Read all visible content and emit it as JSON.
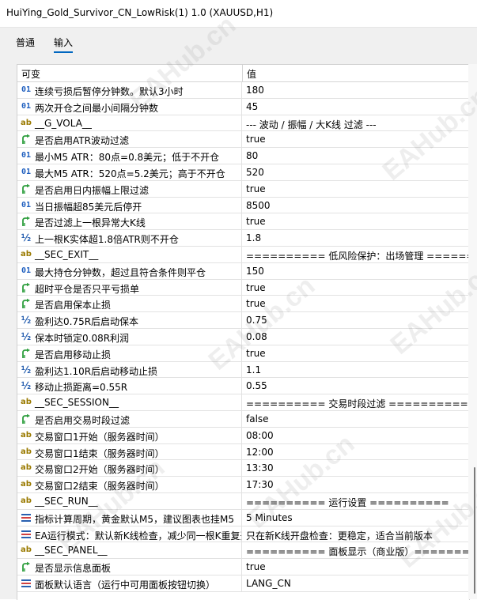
{
  "window": {
    "title": "HuiYing_Gold_Survivor_CN_LowRisk(1) 1.0 (XAUUSD,H1)"
  },
  "tabs": [
    {
      "label": "普通",
      "active": false
    },
    {
      "label": "输入",
      "active": true
    }
  ],
  "table": {
    "headers": {
      "name": "可变",
      "value": "值"
    },
    "rows": [
      {
        "type": "int",
        "name": "连续亏损后暂停分钟数。默认3小时",
        "value": "180"
      },
      {
        "type": "int",
        "name": "两次开仓之间最小间隔分钟数",
        "value": "45"
      },
      {
        "type": "str",
        "name": "__G_VOLA__",
        "value": "--- 波动 / 振幅 / 大K线 过滤 ---"
      },
      {
        "type": "bool",
        "name": "是否启用ATR波动过滤",
        "value": "true"
      },
      {
        "type": "int",
        "name": "最小M5 ATR：80点=0.8美元；低于不开仓",
        "value": "80"
      },
      {
        "type": "int",
        "name": "最大M5 ATR：520点=5.2美元；高于不开仓",
        "value": "520"
      },
      {
        "type": "bool",
        "name": "是否启用日内振幅上限过滤",
        "value": "true"
      },
      {
        "type": "int",
        "name": "当日振幅超85美元后停开",
        "value": "8500"
      },
      {
        "type": "bool",
        "name": "是否过滤上一根异常大K线",
        "value": "true"
      },
      {
        "type": "dbl",
        "name": "上一根K实体超1.8倍ATR则不开仓",
        "value": "1.8"
      },
      {
        "type": "str",
        "name": "__SEC_EXIT__",
        "value": "========== 低风险保护：出场管理 =========="
      },
      {
        "type": "int",
        "name": "最大持仓分钟数，超过且符合条件则平仓",
        "value": "150"
      },
      {
        "type": "bool",
        "name": "超时平仓是否只平亏损单",
        "value": "true"
      },
      {
        "type": "bool",
        "name": "是否启用保本止损",
        "value": "true"
      },
      {
        "type": "dbl",
        "name": "盈利达0.75R后启动保本",
        "value": "0.75"
      },
      {
        "type": "dbl",
        "name": "保本时锁定0.08R利润",
        "value": "0.08"
      },
      {
        "type": "bool",
        "name": "是否启用移动止损",
        "value": "true"
      },
      {
        "type": "dbl",
        "name": "盈利达1.10R后启动移动止损",
        "value": "1.1"
      },
      {
        "type": "dbl",
        "name": "移动止损距离=0.55R",
        "value": "0.55"
      },
      {
        "type": "str",
        "name": "__SEC_SESSION__",
        "value": "========== 交易时段过滤 =========="
      },
      {
        "type": "bool",
        "name": "是否启用交易时段过滤",
        "value": "false"
      },
      {
        "type": "str",
        "name": "交易窗口1开始（服务器时间）",
        "value": "08:00"
      },
      {
        "type": "str",
        "name": "交易窗口1结束（服务器时间）",
        "value": "12:00"
      },
      {
        "type": "str",
        "name": "交易窗口2开始（服务器时间）",
        "value": "13:30"
      },
      {
        "type": "str",
        "name": "交易窗口2结束（服务器时间）",
        "value": "17:30"
      },
      {
        "type": "str",
        "name": "__SEC_RUN__",
        "value": "========== 运行设置 =========="
      },
      {
        "type": "enum",
        "name": "指标计算周期，黄金默认M5，建议图表也挂M5",
        "value": "5 Minutes"
      },
      {
        "type": "enum",
        "name": "EA运行模式：默认新K线检查，减少同一根K重复开仓",
        "value": "只在新K线开盘检查：更稳定，适合当前版本"
      },
      {
        "type": "str",
        "name": "__SEC_PANEL__",
        "value": "========== 面板显示（商业版）=========="
      },
      {
        "type": "bool",
        "name": "是否显示信息面板",
        "value": "true"
      },
      {
        "type": "enum",
        "name": "面板默认语言（运行中可用面板按钮切换）",
        "value": "LANG_CN"
      }
    ]
  },
  "icons": {
    "int": "01",
    "str": "ab",
    "dbl": "½",
    "bool": "bool-arrow-icon",
    "enum": "list-enum-icon"
  },
  "colors": {
    "int_icon": "#1f5fbf",
    "str_icon": "#9a7a00",
    "bool_icon": "#2e9e3e",
    "enum_icon": "#2860b0",
    "tab_underline": "#0067c0"
  }
}
